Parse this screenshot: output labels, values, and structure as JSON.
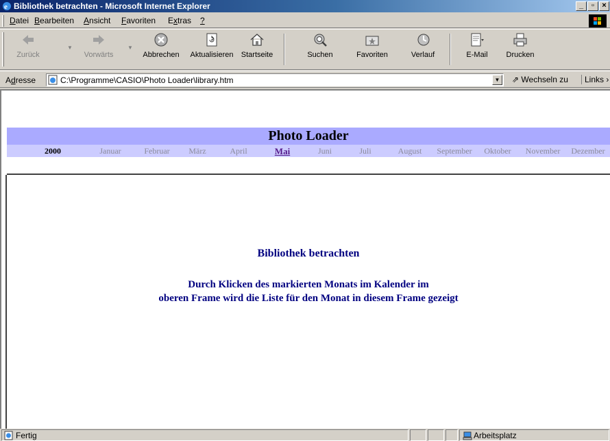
{
  "window": {
    "title": "Bibliothek betrachten - Microsoft Internet Explorer",
    "controls": {
      "minimize": "_",
      "maximize": "▫",
      "close": "×"
    }
  },
  "menu": {
    "items": [
      {
        "label": "Datei",
        "accel": "D",
        "rest": "atei"
      },
      {
        "label": "Bearbeiten",
        "accel": "B",
        "rest": "earbeiten"
      },
      {
        "label": "Ansicht",
        "accel": "A",
        "rest": "nsicht"
      },
      {
        "label": "Favoriten",
        "accel": "F",
        "rest": "avoriten"
      },
      {
        "label": "Extras",
        "accel": "x",
        "pre": "E",
        "rest": "tras"
      },
      {
        "label": "?",
        "accel": "?",
        "rest": ""
      }
    ]
  },
  "toolbar": {
    "back": "Zurück",
    "forward": "Vorwärts",
    "stop": "Abbrechen",
    "refresh": "Aktualisieren",
    "home": "Startseite",
    "search": "Suchen",
    "favorites": "Favoriten",
    "history": "Verlauf",
    "mail": "E-Mail",
    "print": "Drucken"
  },
  "address": {
    "label": "Adresse",
    "label_accel": "d",
    "url": "C:\\Programme\\CASIO\\Photo Loader\\library.htm",
    "go": "Wechseln zu",
    "links": "Links"
  },
  "calendar": {
    "title": "Photo Loader",
    "year": "2000",
    "months": [
      "Januar",
      "Februar",
      "März",
      "April",
      "Mai",
      "Juni",
      "Juli",
      "August",
      "September",
      "Oktober",
      "November",
      "Dezember"
    ],
    "active_month": "Mai"
  },
  "main": {
    "headline": "Bibliothek betrachten",
    "line1": "Durch Klicken des markierten Monats im Kalender im",
    "line2": "oberen Frame wird die Liste für den Monat in diesem Frame gezeigt"
  },
  "status": {
    "text": "Fertig",
    "zone": "Arbeitsplatz"
  },
  "colors": {
    "banner": "#aaaaff",
    "month_row": "#ccccff",
    "text_navy": "#000080",
    "active_link": "#551a8b"
  }
}
